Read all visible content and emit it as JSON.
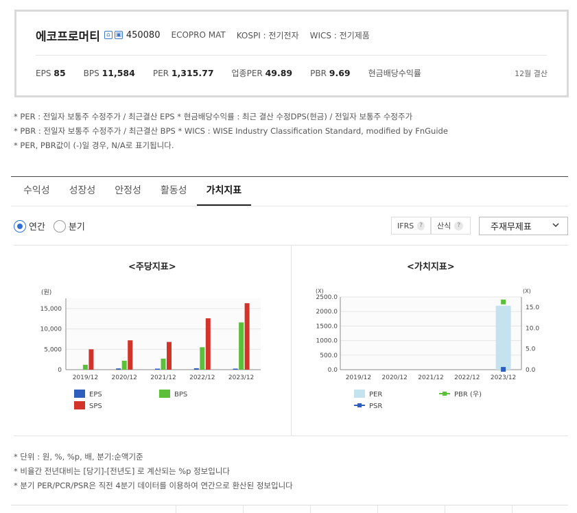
{
  "header": {
    "company": "에코프로머티",
    "code": "450080",
    "english_name": "ECOPRO MAT",
    "market": "KOSPI : 전기전자",
    "wics": "WICS : 전기제품",
    "stats": [
      {
        "label": "EPS",
        "value": "85"
      },
      {
        "label": "BPS",
        "value": "11,584"
      },
      {
        "label": "PER",
        "value": "1,315.77"
      },
      {
        "label": "업종PER",
        "value": "49.89"
      },
      {
        "label": "PBR",
        "value": "9.69"
      },
      {
        "label": "현금배당수익률",
        "value": ""
      }
    ],
    "settlement": "12월 결산"
  },
  "notes": [
    "* PER : 전일자 보통주 수정주가 / 최근결산 EPS * 현금배당수익률 : 최근 결산 수정DPS(현금) / 전일자 보통주 수정주가",
    "* PBR : 전일자 보통주 수정주가 / 최근결산 BPS * WICS : WISE Industry Classification Standard, modified by FnGuide",
    "* PER, PBR값이 (-)일 경우, N/A로 표기됩니다."
  ],
  "tabs": [
    {
      "label": "수익성",
      "active": false
    },
    {
      "label": "성장성",
      "active": false
    },
    {
      "label": "안정성",
      "active": false
    },
    {
      "label": "활동성",
      "active": false
    },
    {
      "label": "가치지표",
      "active": true
    }
  ],
  "period": {
    "annual": "연간",
    "quarter": "분기",
    "selected": "annual"
  },
  "options": {
    "ifrs": "IFRS",
    "formula": "산식",
    "q": "?",
    "select_value": "주재무제표"
  },
  "chart_data": [
    {
      "type": "bar",
      "title": "<주당지표>",
      "ylabel": "(원)",
      "categories": [
        "2019/12",
        "2020/12",
        "2021/12",
        "2022/12",
        "2023/12"
      ],
      "ylim": [
        0,
        17500
      ],
      "yticks": [
        0,
        5000,
        10000,
        15000
      ],
      "ytick_labels": [
        "0",
        "5,000",
        "10,000",
        "15,000"
      ],
      "series": [
        {
          "name": "EPS",
          "color": "#2e5fbf",
          "values": [
            0,
            300,
            200,
            350,
            85
          ]
        },
        {
          "name": "BPS",
          "color": "#5cbf3a",
          "values": [
            1200,
            2200,
            2700,
            5500,
            11584
          ]
        },
        {
          "name": "SPS",
          "color": "#d2342a",
          "values": [
            5000,
            7200,
            6800,
            12600,
            16300
          ]
        }
      ],
      "legend_position": "bottom"
    },
    {
      "type": "bar",
      "title": "<가치지표>",
      "ylabel": "(X)",
      "y2label": "(X)",
      "categories": [
        "2019/12",
        "2020/12",
        "2021/12",
        "2022/12",
        "2023/12"
      ],
      "ylim": [
        0,
        2500
      ],
      "yticks": [
        0,
        500,
        1000,
        1500,
        2000,
        2500
      ],
      "ytick_labels": [
        "0.0",
        "500.0",
        "1000.0",
        "1500.0",
        "2000.0",
        "2500.0"
      ],
      "y2lim": [
        0,
        17.5
      ],
      "y2ticks": [
        0,
        5,
        10,
        15
      ],
      "y2tick_labels": [
        "0.0",
        "5.0",
        "10.0",
        "15.0"
      ],
      "series": [
        {
          "name": "PER",
          "color": "#c5e3ee",
          "axis": "left",
          "kind": "bar",
          "values": [
            null,
            null,
            null,
            null,
            2200
          ]
        },
        {
          "name": "PBR (우)",
          "color": "#5cbf3a",
          "axis": "right",
          "kind": "line",
          "values": [
            null,
            null,
            null,
            null,
            16.3
          ]
        },
        {
          "name": "PSR",
          "color": "#2e5fbf",
          "axis": "left",
          "kind": "line",
          "values": [
            null,
            null,
            null,
            null,
            10
          ]
        }
      ],
      "legend_position": "bottom"
    }
  ],
  "bottom_notes": [
    "* 단위 : 원, %, %p, 배, 분기:순액기준",
    "* 비율간 전년대비는 [당기]-[전년도] 로 계산되는 %p 정보입니다",
    "* 분기 PER/PCR/PSR은 직전 4분기 데이터를 이용하여 연간으로 환산된 정보입니다"
  ]
}
